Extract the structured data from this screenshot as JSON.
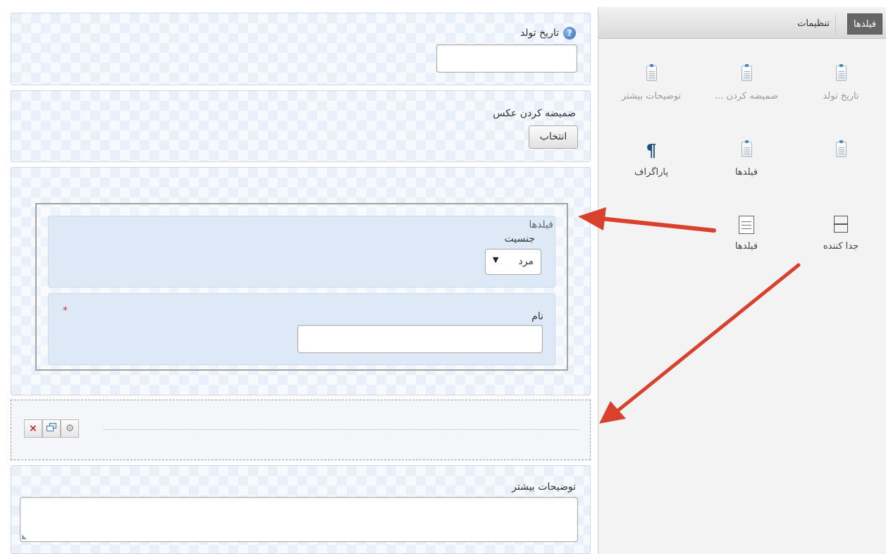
{
  "tabs": {
    "fields": "فیلدها",
    "settings": "تنظیمات"
  },
  "toolbox": {
    "row1": [
      "تاریخ تولد",
      "ضمیضه کردن ...",
      "توضیحات بیشتر"
    ],
    "row2": [
      "",
      "فیلدها",
      "پاراگراف"
    ],
    "row3": [
      "جدا کننده",
      "فیلدها"
    ]
  },
  "form": {
    "birthdate_label": "تاریخ تولد",
    "photo_label": "ضمیضه کردن عکس",
    "choose_button": "انتخاب",
    "group_title": "فیلدها",
    "gender_label": "جنسیت",
    "gender_value": "مرد",
    "name_label": "نام",
    "required_mark": "*",
    "notes_label": "توضیحات بیشتر"
  },
  "colors": {
    "arrow": "#d9412c",
    "active_tab": "#666666",
    "panel_bg": "#e9f0fa"
  }
}
